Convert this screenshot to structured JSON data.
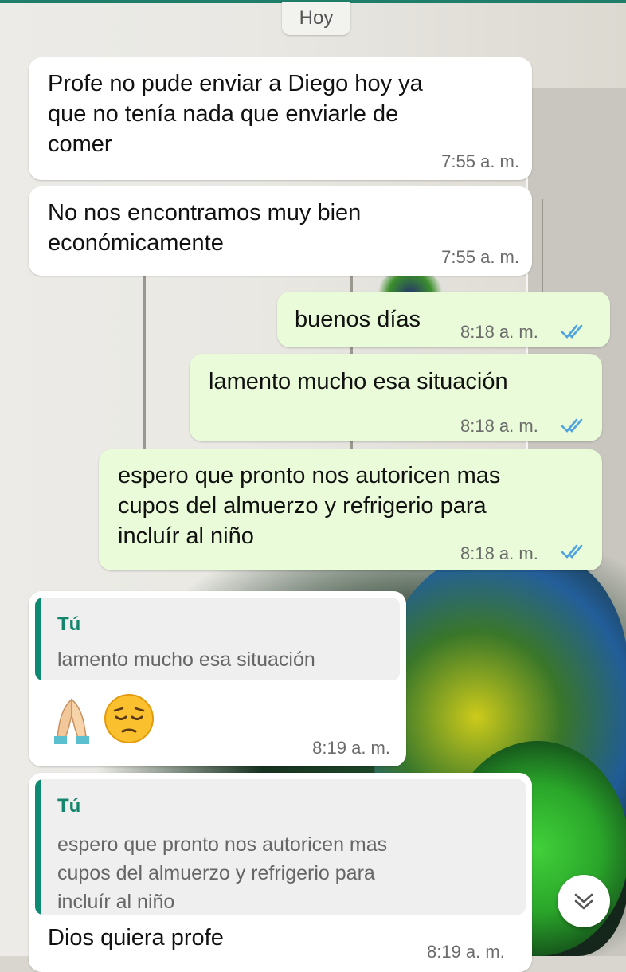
{
  "date_chip": "Hoy",
  "colors": {
    "incoming_bg": "#ffffff",
    "outgoing_bg": "#e9fbd9",
    "tick_read": "#4fa3e0",
    "quote_accent": "#0e8a72"
  },
  "messages": [
    {
      "text": "Profe no pude enviar a Diego hoy ya\nque no tenía nada que enviarle de\ncomer",
      "time": "7:55 a. m."
    },
    {
      "text": "No nos encontramos muy bien\neconómicamente",
      "time": "7:55 a. m."
    },
    {
      "text": "buenos días",
      "time": "8:18 a. m.",
      "status": "read"
    },
    {
      "text": "lamento  mucho esa situación",
      "time": "8:18 a. m.",
      "status": "read"
    },
    {
      "text": "espero que pronto nos autoricen mas\ncupos del almuerzo y refrigerio para\nincluír al niño",
      "time": "8:18 a. m.",
      "status": "read"
    },
    {
      "quote_author": "Tú",
      "quote_text": "lamento  mucho esa situación",
      "emojis": [
        "folded-hands-emoji",
        "pensive-face-emoji"
      ],
      "time": "8:19 a. m."
    },
    {
      "quote_author": "Tú",
      "quote_text": "espero que pronto nos autoricen mas\ncupos del almuerzo y refrigerio para\nincluír al niño",
      "text": "Dios quiera profe",
      "time": "8:19 a. m."
    }
  ],
  "scroll_button_icon": "double-chevron-down-icon"
}
